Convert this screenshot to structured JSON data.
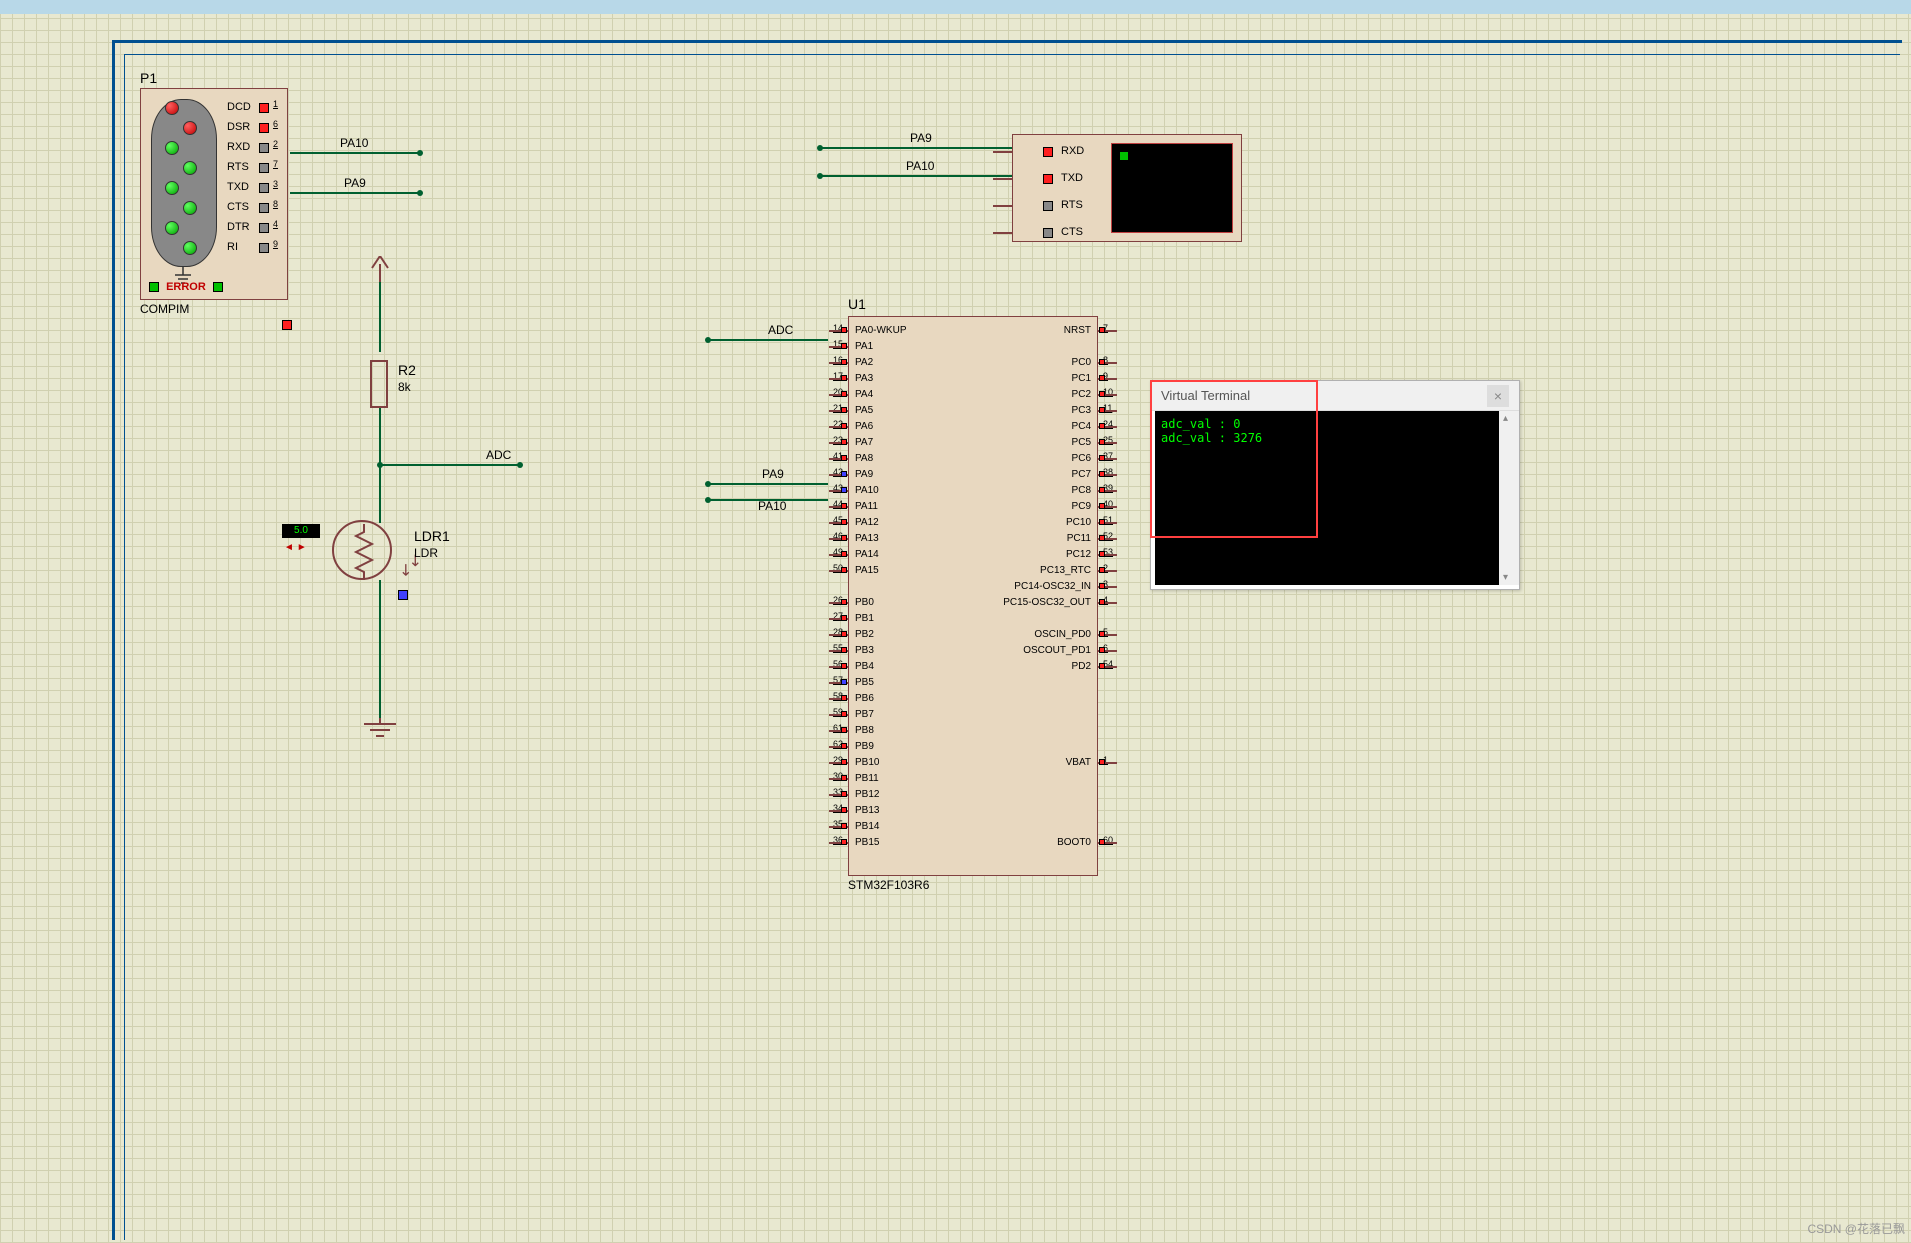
{
  "compim": {
    "ref": "P1",
    "name": "COMPIM",
    "error": "ERROR",
    "pins": [
      {
        "label": "DCD",
        "num": "1",
        "led": "red"
      },
      {
        "label": "DSR",
        "num": "6",
        "led": "red"
      },
      {
        "label": "RXD",
        "num": "2",
        "led": "green"
      },
      {
        "label": "RTS",
        "num": "7",
        "led": "green"
      },
      {
        "label": "TXD",
        "num": "3",
        "led": "green"
      },
      {
        "label": "CTS",
        "num": "8",
        "led": "green"
      },
      {
        "label": "DTR",
        "num": "4",
        "led": "green"
      },
      {
        "label": "RI",
        "num": "9",
        "led": "green"
      }
    ],
    "rxd_net": "PA10",
    "txd_net": "PA9"
  },
  "resistor": {
    "ref": "R2",
    "value": "8k"
  },
  "ldr": {
    "ref": "LDR1",
    "part": "LDR",
    "meter": "5.0"
  },
  "net_adc": "ADC",
  "vt": {
    "ref": "",
    "rxd": "RXD",
    "txd": "TXD",
    "rts": "RTS",
    "cts": "CTS",
    "rxd_net": "PA9",
    "txd_net": "PA10"
  },
  "chip": {
    "ref": "U1",
    "part": "STM32F103R6",
    "left_pins": [
      {
        "name": "PA0-WKUP",
        "num": "14"
      },
      {
        "name": "PA1",
        "num": "15"
      },
      {
        "name": "PA2",
        "num": "16"
      },
      {
        "name": "PA3",
        "num": "17"
      },
      {
        "name": "PA4",
        "num": "20"
      },
      {
        "name": "PA5",
        "num": "21"
      },
      {
        "name": "PA6",
        "num": "22"
      },
      {
        "name": "PA7",
        "num": "23"
      },
      {
        "name": "PA8",
        "num": "41"
      },
      {
        "name": "PA9",
        "num": "42"
      },
      {
        "name": "PA10",
        "num": "43"
      },
      {
        "name": "PA11",
        "num": "44"
      },
      {
        "name": "PA12",
        "num": "45"
      },
      {
        "name": "PA13",
        "num": "46"
      },
      {
        "name": "PA14",
        "num": "49"
      },
      {
        "name": "PA15",
        "num": "50"
      },
      {
        "name": "",
        "num": ""
      },
      {
        "name": "PB0",
        "num": "26"
      },
      {
        "name": "PB1",
        "num": "27"
      },
      {
        "name": "PB2",
        "num": "28"
      },
      {
        "name": "PB3",
        "num": "55"
      },
      {
        "name": "PB4",
        "num": "56"
      },
      {
        "name": "PB5",
        "num": "57"
      },
      {
        "name": "PB6",
        "num": "58"
      },
      {
        "name": "PB7",
        "num": "59"
      },
      {
        "name": "PB8",
        "num": "61"
      },
      {
        "name": "PB9",
        "num": "62"
      },
      {
        "name": "PB10",
        "num": "29"
      },
      {
        "name": "PB11",
        "num": "30"
      },
      {
        "name": "PB12",
        "num": "33"
      },
      {
        "name": "PB13",
        "num": "34"
      },
      {
        "name": "PB14",
        "num": "35"
      },
      {
        "name": "PB15",
        "num": "36"
      }
    ],
    "right_pins": [
      {
        "name": "NRST",
        "num": "7"
      },
      {
        "name": "",
        "num": ""
      },
      {
        "name": "PC0",
        "num": "8"
      },
      {
        "name": "PC1",
        "num": "9"
      },
      {
        "name": "PC2",
        "num": "10"
      },
      {
        "name": "PC3",
        "num": "11"
      },
      {
        "name": "PC4",
        "num": "24"
      },
      {
        "name": "PC5",
        "num": "25"
      },
      {
        "name": "PC6",
        "num": "37"
      },
      {
        "name": "PC7",
        "num": "38"
      },
      {
        "name": "PC8",
        "num": "39"
      },
      {
        "name": "PC9",
        "num": "40"
      },
      {
        "name": "PC10",
        "num": "51"
      },
      {
        "name": "PC11",
        "num": "52"
      },
      {
        "name": "PC12",
        "num": "53"
      },
      {
        "name": "PC13_RTC",
        "num": "2"
      },
      {
        "name": "PC14-OSC32_IN",
        "num": "3"
      },
      {
        "name": "PC15-OSC32_OUT",
        "num": "4"
      },
      {
        "name": "",
        "num": ""
      },
      {
        "name": "OSCIN_PD0",
        "num": "5"
      },
      {
        "name": "OSCOUT_PD1",
        "num": "6"
      },
      {
        "name": "PD2",
        "num": "54"
      },
      {
        "name": "",
        "num": ""
      },
      {
        "name": "",
        "num": ""
      },
      {
        "name": "",
        "num": ""
      },
      {
        "name": "",
        "num": ""
      },
      {
        "name": "",
        "num": ""
      },
      {
        "name": "VBAT",
        "num": "1"
      },
      {
        "name": "",
        "num": ""
      },
      {
        "name": "",
        "num": ""
      },
      {
        "name": "",
        "num": ""
      },
      {
        "name": "",
        "num": ""
      },
      {
        "name": "BOOT0",
        "num": "60"
      }
    ],
    "net_adc": "ADC",
    "net_pa9": "PA9",
    "net_pa10": "PA10"
  },
  "terminal": {
    "title": "Virtual Terminal",
    "lines": [
      "adc_val : 0",
      "adc_val : 3276"
    ]
  },
  "watermark": "CSDN @花落已飘"
}
